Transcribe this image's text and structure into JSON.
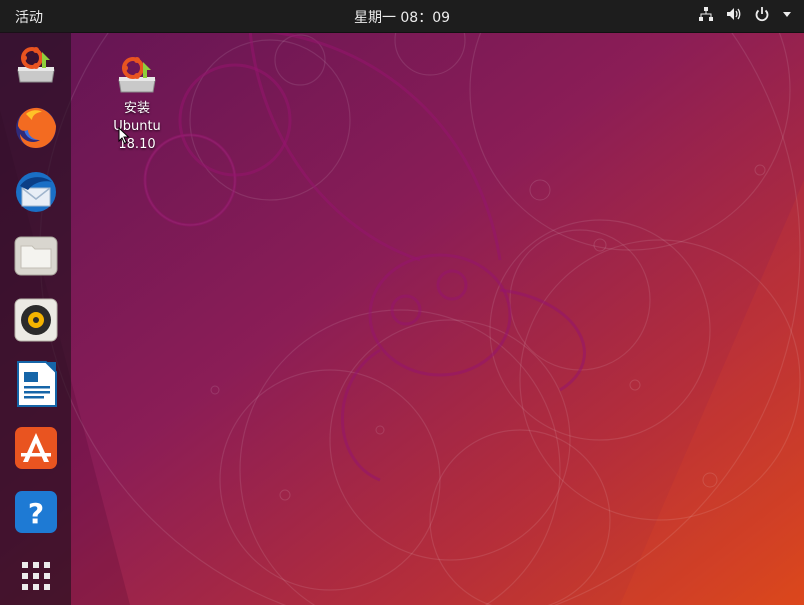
{
  "topbar": {
    "activities_label": "活动",
    "clock": "星期一 08：09"
  },
  "tray": {
    "icons": [
      "network-icon",
      "volume-icon",
      "power-icon",
      "menu-arrow-icon"
    ]
  },
  "dock": {
    "items": [
      {
        "name": "install-ubuntu",
        "icon": "installer-icon"
      },
      {
        "name": "firefox",
        "icon": "firefox-icon"
      },
      {
        "name": "thunderbird",
        "icon": "thunderbird-icon"
      },
      {
        "name": "files",
        "icon": "files-icon"
      },
      {
        "name": "rhythmbox",
        "icon": "rhythmbox-icon"
      },
      {
        "name": "libreoffice-writer",
        "icon": "writer-icon"
      },
      {
        "name": "ubuntu-software",
        "icon": "software-icon"
      },
      {
        "name": "help",
        "icon": "help-icon"
      },
      {
        "name": "show-applications",
        "icon": "app-grid-icon"
      }
    ]
  },
  "desktop": {
    "icon_label_line1": "安装",
    "icon_label_line2": "Ubuntu",
    "icon_label_line3": "18.10"
  },
  "colors": {
    "topbar": "#1d1d1d",
    "wallpaper_top": "#6e1a5d",
    "wallpaper_bottom": "#d4431d",
    "ubuntu_orange": "#e95420"
  }
}
